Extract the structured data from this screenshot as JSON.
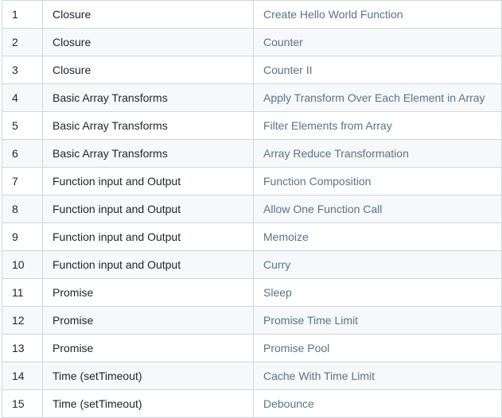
{
  "colors": {
    "border": "#d0d7de",
    "stripe": "#f6f8fa",
    "text": "#1f2328",
    "link": "#5b7388"
  },
  "rows": [
    {
      "num": "1",
      "topic": "Closure",
      "problem": "Create Hello World Function"
    },
    {
      "num": "2",
      "topic": "Closure",
      "problem": "Counter"
    },
    {
      "num": "3",
      "topic": "Closure",
      "problem": "Counter II"
    },
    {
      "num": "4",
      "topic": "Basic Array Transforms",
      "problem": "Apply Transform Over Each Element in Array"
    },
    {
      "num": "5",
      "topic": "Basic Array Transforms",
      "problem": "Filter Elements from Array"
    },
    {
      "num": "6",
      "topic": "Basic Array Transforms",
      "problem": "Array Reduce Transformation"
    },
    {
      "num": "7",
      "topic": "Function input and Output",
      "problem": "Function Composition"
    },
    {
      "num": "8",
      "topic": "Function input and Output",
      "problem": "Allow One Function Call"
    },
    {
      "num": "9",
      "topic": "Function input and Output",
      "problem": "Memoize"
    },
    {
      "num": "10",
      "topic": "Function input and Output",
      "problem": "Curry"
    },
    {
      "num": "11",
      "topic": "Promise",
      "problem": "Sleep"
    },
    {
      "num": "12",
      "topic": "Promise",
      "problem": "Promise Time Limit"
    },
    {
      "num": "13",
      "topic": "Promise",
      "problem": "Promise Pool"
    },
    {
      "num": "14",
      "topic": "Time (setTimeout)",
      "problem": "Cache With Time Limit"
    },
    {
      "num": "15",
      "topic": "Time (setTimeout)",
      "problem": "Debounce"
    }
  ]
}
